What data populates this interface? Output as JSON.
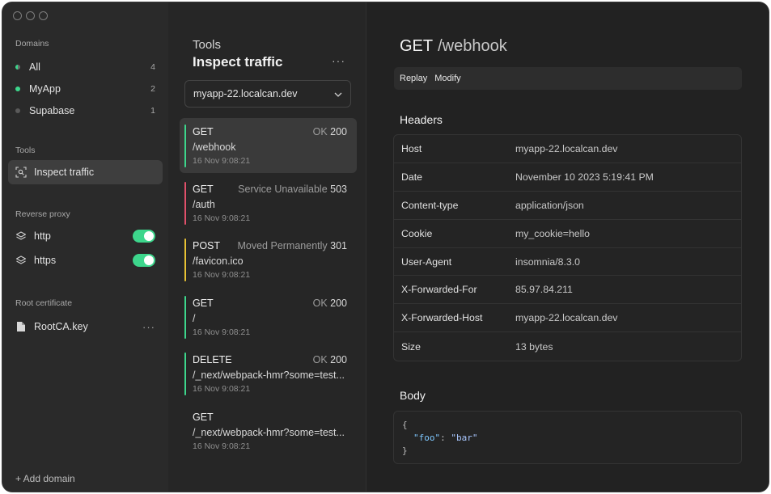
{
  "sidebar": {
    "domains_title": "Domains",
    "domains": [
      {
        "label": "All",
        "count": "4"
      },
      {
        "label": "MyApp",
        "count": "2"
      },
      {
        "label": "Supabase",
        "count": "1"
      }
    ],
    "tools_title": "Tools",
    "tools": [
      {
        "label": "Inspect traffic"
      }
    ],
    "proxy_title": "Reverse proxy",
    "proxies": [
      {
        "label": "http",
        "enabled": true
      },
      {
        "label": "https",
        "enabled": true
      }
    ],
    "cert_title": "Root certificate",
    "cert": {
      "label": "RootCA.key",
      "more": "···"
    },
    "add_domain": "+ Add domain"
  },
  "middle": {
    "subtitle": "Tools",
    "title": "Inspect traffic",
    "more": "···",
    "domain_select": "myapp-22.localcan.dev",
    "requests": [
      {
        "method": "GET",
        "status_text": "OK",
        "status_code": "200",
        "path": "/webhook",
        "time": "16 Nov 9:08:21",
        "color": "#3dd68c"
      },
      {
        "method": "GET",
        "status_text": "Service Unavailable",
        "status_code": "503",
        "path": "/auth",
        "time": "16 Nov 9:08:21",
        "color": "#e0506a"
      },
      {
        "method": "POST",
        "status_text": "Moved Permanently",
        "status_code": "301",
        "path": "/favicon.ico",
        "time": "16 Nov 9:08:21",
        "color": "#e8c234"
      },
      {
        "method": "GET",
        "status_text": "OK",
        "status_code": "200",
        "path": "/",
        "time": "16 Nov 9:08:21",
        "color": "#3dd68c"
      },
      {
        "method": "DELETE",
        "status_text": "OK",
        "status_code": "200",
        "path": "/_next/webpack-hmr?some=test...",
        "time": "16 Nov 9:08:21",
        "color": "#3dd68c"
      },
      {
        "method": "GET",
        "status_text": "",
        "status_code": "",
        "path": "/_next/webpack-hmr?some=test...",
        "time": "16 Nov 9:08:21",
        "color": ""
      }
    ]
  },
  "detail": {
    "method": "GET",
    "path": "/webhook",
    "actions": {
      "replay": "Replay",
      "modify": "Modify"
    },
    "headers_title": "Headers",
    "headers": [
      {
        "key": "Host",
        "value": "myapp-22.localcan.dev"
      },
      {
        "key": "Date",
        "value": "November 10 2023 5:19:41 PM"
      },
      {
        "key": "Content-type",
        "value": "application/json"
      },
      {
        "key": "Cookie",
        "value": "my_cookie=hello"
      },
      {
        "key": "User-Agent",
        "value": "insomnia/8.3.0"
      },
      {
        "key": "X-Forwarded-For",
        "value": "85.97.84.211"
      },
      {
        "key": "X-Forwarded-Host",
        "value": "myapp-22.localcan.dev"
      },
      {
        "key": "Size",
        "value": "13 bytes"
      }
    ],
    "body_title": "Body",
    "body": {
      "open": "{",
      "key": "\"foo\"",
      "sep": ": ",
      "value": "\"bar\"",
      "close": "}"
    }
  }
}
